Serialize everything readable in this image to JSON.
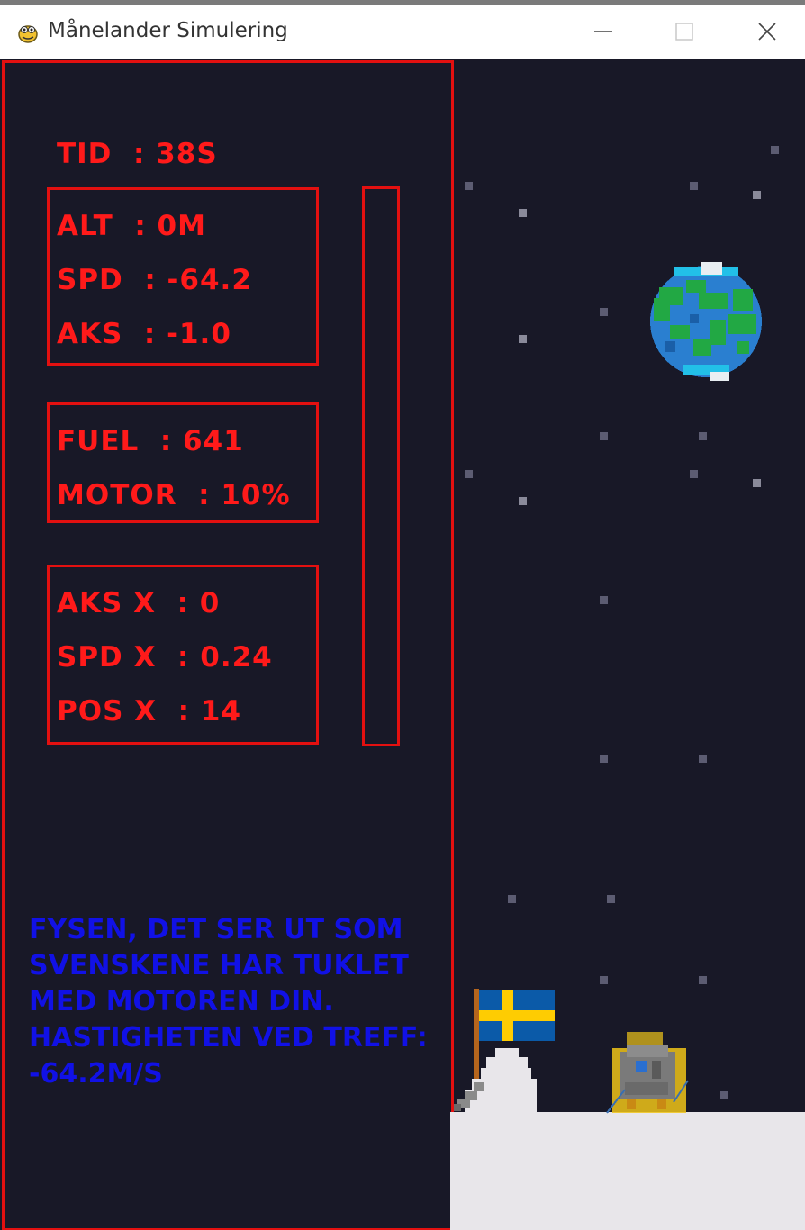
{
  "window": {
    "title": "Månelander Simulering",
    "app_icon": "pygame-snake-icon",
    "minimize_icon": "minimize-icon",
    "maximize_icon": "maximize-icon",
    "close_icon": "close-icon"
  },
  "hud": {
    "time": "TID  : 38S",
    "vertical": {
      "alt": "ALT  : 0M",
      "spd": "SPD  : -64.2",
      "aks": "AKS  : -1.0"
    },
    "engine": {
      "fuel": "FUEL  : 641",
      "motor": "MOTOR  : 10%"
    },
    "horizontal": {
      "aks_x": "AKS X  : 0",
      "spd_x": "SPD X  : 0.24",
      "pos_x": "POS X  : 14"
    },
    "fuel_gauge_level": 0
  },
  "message": {
    "lines": [
      "FYSEN, DET SER UT SOM",
      "SVENSKENE HAR TUKLET",
      "MED MOTOREN DIN.",
      "HASTIGHETEN VED TREFF:",
      "-64.2M/S"
    ]
  },
  "scene": {
    "earth": "earth-icon",
    "flag": "swedish-flag-icon",
    "lander": "lunar-lander-icon",
    "colors": {
      "hud": "#e31010",
      "message": "#1111e6",
      "space": "#181827",
      "ground": "#e8e6ea"
    }
  }
}
